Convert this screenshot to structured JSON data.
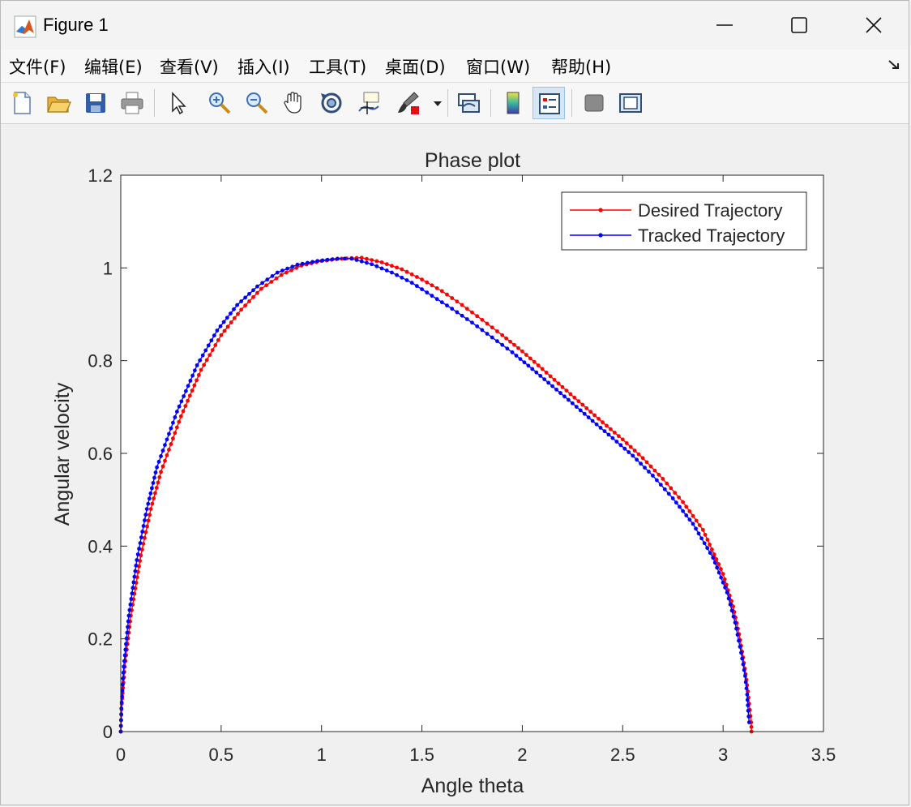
{
  "window": {
    "title": "Figure 1",
    "icon": "matlab-logo-icon",
    "controls": [
      "minimize-icon",
      "maximize-icon",
      "close-icon"
    ]
  },
  "menubar": {
    "items": [
      "文件(F)",
      "编辑(E)",
      "查看(V)",
      "插入(I)",
      "工具(T)",
      "桌面(D)",
      "窗口(W)",
      "帮助(H)"
    ]
  },
  "toolbar": {
    "buttons": [
      {
        "icon": "new-figure-icon"
      },
      {
        "icon": "open-file-icon"
      },
      {
        "icon": "save-icon"
      },
      {
        "icon": "print-icon"
      },
      {
        "icon": "edit-plot-arrow-icon"
      },
      {
        "icon": "zoom-in-icon"
      },
      {
        "icon": "zoom-out-icon"
      },
      {
        "icon": "pan-hand-icon"
      },
      {
        "icon": "rotate-3d-icon"
      },
      {
        "icon": "data-cursor-icon"
      },
      {
        "icon": "brush-icon"
      },
      {
        "icon": "link-plot-icon"
      },
      {
        "icon": "insert-colorbar-icon"
      },
      {
        "icon": "insert-legend-icon",
        "active": true
      },
      {
        "icon": "hide-plot-tools-icon"
      },
      {
        "icon": "show-plot-tools-icon"
      }
    ]
  },
  "chart_data": {
    "type": "line",
    "title": "Phase plot",
    "xlabel": "Angle theta",
    "ylabel": "Angular velocity",
    "xlim": [
      0,
      3.5
    ],
    "ylim": [
      0,
      1.2
    ],
    "xticks": [
      "0",
      "0.5",
      "1",
      "1.5",
      "2",
      "2.5",
      "3",
      "3.5"
    ],
    "yticks": [
      "0",
      "0.2",
      "0.4",
      "0.6",
      "0.8",
      "1",
      "1.2"
    ],
    "grid": false,
    "legend": {
      "location": "top-right",
      "entries": [
        "Desired Trajectory",
        "Tracked Trajectory"
      ]
    },
    "series": [
      {
        "name": "Desired Trajectory",
        "color": "#ff0000",
        "marker": "dot",
        "x": [
          0,
          0.005,
          0.02,
          0.05,
          0.1,
          0.15,
          0.2,
          0.3,
          0.4,
          0.5,
          0.6,
          0.7,
          0.8,
          0.9,
          1.0,
          1.1,
          1.2,
          1.3,
          1.4,
          1.5,
          1.6,
          1.7,
          1.8,
          1.9,
          2.0,
          2.1,
          2.2,
          2.3,
          2.4,
          2.5,
          2.6,
          2.7,
          2.8,
          2.9,
          3.0,
          3.05,
          3.08,
          3.1,
          3.12,
          3.13,
          3.14,
          3.1416
        ],
        "y": [
          0,
          0.06,
          0.14,
          0.25,
          0.38,
          0.48,
          0.56,
          0.68,
          0.78,
          0.855,
          0.91,
          0.955,
          0.985,
          1.005,
          1.015,
          1.02,
          1.022,
          1.012,
          0.997,
          0.975,
          0.95,
          0.92,
          0.888,
          0.855,
          0.82,
          0.782,
          0.743,
          0.705,
          0.667,
          0.63,
          0.59,
          0.545,
          0.495,
          0.435,
          0.34,
          0.27,
          0.21,
          0.16,
          0.1,
          0.06,
          0.02,
          0
        ]
      },
      {
        "name": "Tracked Trajectory",
        "color": "#0000ff",
        "marker": "dot",
        "x": [
          0,
          0.003,
          0.015,
          0.04,
          0.08,
          0.13,
          0.18,
          0.28,
          0.38,
          0.48,
          0.58,
          0.68,
          0.78,
          0.88,
          0.98,
          1.08,
          1.15,
          1.25,
          1.35,
          1.45,
          1.55,
          1.65,
          1.75,
          1.85,
          1.95,
          2.05,
          2.15,
          2.25,
          2.35,
          2.45,
          2.55,
          2.65,
          2.75,
          2.85,
          2.95,
          3.02,
          3.06,
          3.09,
          3.11,
          3.12,
          3.125,
          3.13
        ],
        "y": [
          0,
          0.05,
          0.14,
          0.25,
          0.37,
          0.48,
          0.57,
          0.69,
          0.79,
          0.865,
          0.92,
          0.96,
          0.99,
          1.007,
          1.015,
          1.02,
          1.02,
          1.008,
          0.99,
          0.968,
          0.94,
          0.912,
          0.882,
          0.85,
          0.818,
          0.782,
          0.745,
          0.708,
          0.67,
          0.633,
          0.595,
          0.552,
          0.503,
          0.448,
          0.375,
          0.3,
          0.235,
          0.17,
          0.12,
          0.08,
          0.045,
          0.02
        ]
      }
    ]
  }
}
